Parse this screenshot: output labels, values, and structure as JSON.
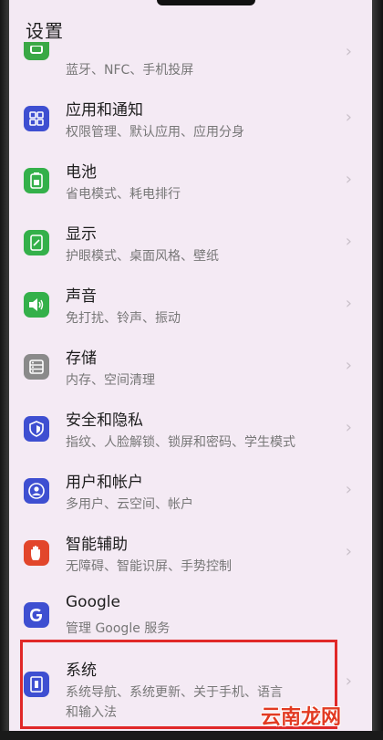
{
  "header": {
    "title": "设置"
  },
  "rows": [
    {
      "title": "",
      "sub": "蓝牙、NFC、手机投屏",
      "icon": "device-connection-icon",
      "color": "#3aa845"
    },
    {
      "title": "应用和通知",
      "sub": "权限管理、默认应用、应用分身",
      "icon": "apps-grid-icon",
      "color": "#3e4fd1"
    },
    {
      "title": "电池",
      "sub": "省电模式、耗电排行",
      "icon": "battery-icon",
      "color": "#34b04a"
    },
    {
      "title": "显示",
      "sub": "护眼模式、桌面风格、壁纸",
      "icon": "display-icon",
      "color": "#34b04a"
    },
    {
      "title": "声音",
      "sub": "免打扰、铃声、振动",
      "icon": "speaker-icon",
      "color": "#34b04a"
    },
    {
      "title": "存储",
      "sub": "内存、空间清理",
      "icon": "storage-icon",
      "color": "#8a8a8a"
    },
    {
      "title": "安全和隐私",
      "sub": "指纹、人脸解锁、锁屏和密码、学生模式",
      "icon": "shield-icon",
      "color": "#3e4fd1"
    },
    {
      "title": "用户和帐户",
      "sub": "多用户、云空间、帐户",
      "icon": "user-icon",
      "color": "#3e4fd1"
    },
    {
      "title": "智能辅助",
      "sub": "无障碍、智能识屏、手势控制",
      "icon": "hand-icon",
      "color": "#e2462b"
    },
    {
      "title": "Google",
      "sub": "管理 Google 服务",
      "icon": "google-icon",
      "color": "#3e4fd1"
    },
    {
      "title": "系统",
      "sub": "系统导航、系统更新、关于手机、语言",
      "sub2": "和输入法",
      "icon": "system-phone-icon",
      "color": "#3e4fd1"
    }
  ],
  "watermark": "云南龙网"
}
